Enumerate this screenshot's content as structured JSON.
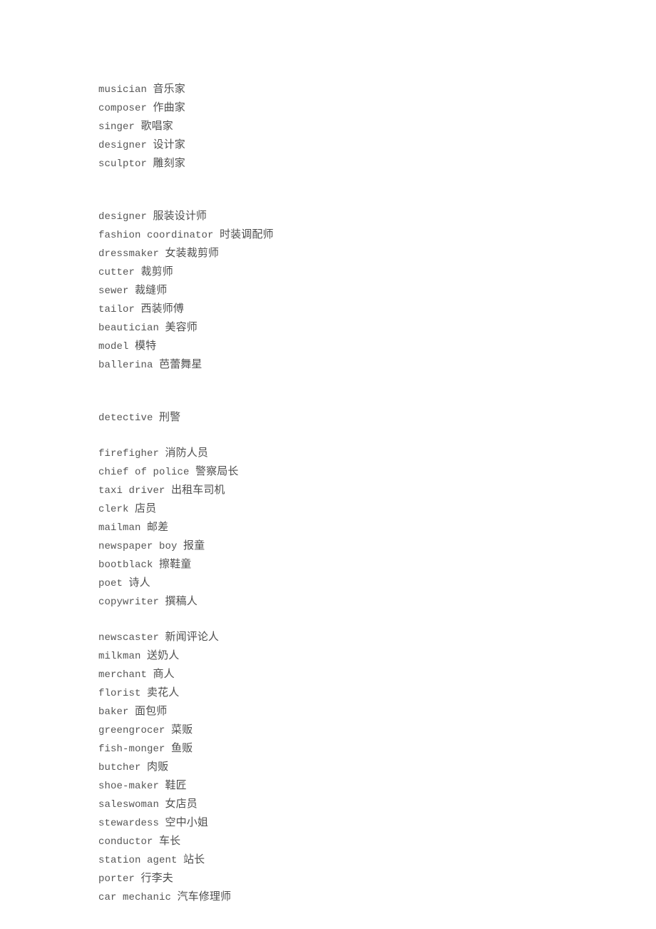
{
  "document": {
    "background_color": "#ffffff",
    "text_color": "#555555",
    "blocks": [
      {
        "name": "arts-occupations",
        "entries": [
          {
            "en": "musician",
            "zh": "音乐家"
          },
          {
            "en": "composer",
            "zh": "作曲家"
          },
          {
            "en": "singer",
            "zh": "歌唱家"
          },
          {
            "en": "designer",
            "zh": "设计家"
          },
          {
            "en": "sculptor",
            "zh": "雕刻家"
          }
        ]
      },
      {
        "name": "fashion-occupations",
        "entries": [
          {
            "en": "designer",
            "zh": "服装设计师"
          },
          {
            "en": "fashion coordinator",
            "zh": "时装调配师"
          },
          {
            "en": "dressmaker",
            "zh": "女装裁剪师"
          },
          {
            "en": "cutter",
            "zh": "裁剪师"
          },
          {
            "en": "sewer",
            "zh": "裁缝师"
          },
          {
            "en": "tailor",
            "zh": "西装师傅"
          },
          {
            "en": "beautician",
            "zh": "美容师"
          },
          {
            "en": "model",
            "zh": "模特"
          },
          {
            "en": "ballerina",
            "zh": "芭蕾舞星"
          }
        ]
      },
      {
        "name": "detective-occupation",
        "entries": [
          {
            "en": "detective",
            "zh": "刑警"
          }
        ]
      },
      {
        "name": "public-service-occupations",
        "entries": [
          {
            "en": "firefigher",
            "zh": "消防人员"
          },
          {
            "en": "chief of police",
            "zh": "警察局长"
          },
          {
            "en": "taxi driver",
            "zh": "出租车司机"
          },
          {
            "en": "clerk",
            "zh": "店员"
          },
          {
            "en": "mailman",
            "zh": "邮差"
          },
          {
            "en": "newspaper boy",
            "zh": "报童"
          },
          {
            "en": "bootblack",
            "zh": "擦鞋童"
          },
          {
            "en": "poet",
            "zh": "诗人"
          },
          {
            "en": "copywriter",
            "zh": "撰稿人"
          }
        ]
      },
      {
        "name": "commerce-and-transport-occupations",
        "entries": [
          {
            "en": "newscaster",
            "zh": "新闻评论人"
          },
          {
            "en": "milkman",
            "zh": "送奶人"
          },
          {
            "en": "merchant",
            "zh": "商人"
          },
          {
            "en": "florist",
            "zh": "卖花人"
          },
          {
            "en": "baker",
            "zh": "面包师"
          },
          {
            "en": "greengrocer",
            "zh": "菜贩"
          },
          {
            "en": "fish-monger",
            "zh": "鱼贩"
          },
          {
            "en": "butcher",
            "zh": "肉贩"
          },
          {
            "en": "shoe-maker",
            "zh": "鞋匠"
          },
          {
            "en": "saleswoman",
            "zh": "女店员"
          },
          {
            "en": "stewardess",
            "zh": "空中小姐"
          },
          {
            "en": "conductor",
            "zh": "车长"
          },
          {
            "en": "station agent",
            "zh": "站长"
          },
          {
            "en": "porter",
            "zh": "行李夫"
          },
          {
            "en": "car mechanic",
            "zh": "汽车修理师"
          }
        ]
      }
    ],
    "block_gaps": [
      2,
      2,
      1,
      1
    ]
  }
}
